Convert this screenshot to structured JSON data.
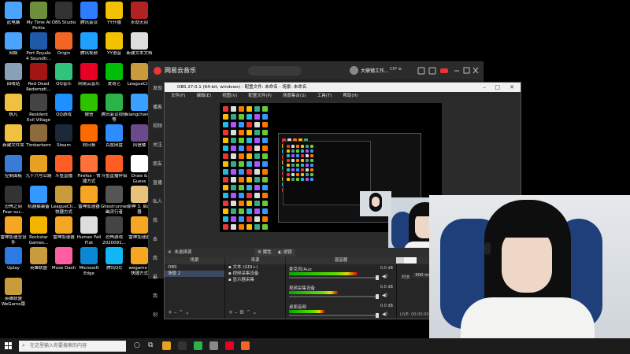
{
  "desktop_icons": [
    {
      "label": "此电脑",
      "color": "#4aa3ff"
    },
    {
      "label": "My Time At Portia",
      "color": "#6b8f3a"
    },
    {
      "label": "OBS Studio",
      "color": "#333333"
    },
    {
      "label": "腾讯会议",
      "color": "#2d7cff"
    },
    {
      "label": "YY开播",
      "color": "#f2c200"
    },
    {
      "label": "永劫无间",
      "color": "#b22222"
    },
    {
      "label": "网络",
      "color": "#4aa3ff"
    },
    {
      "label": "Port Royale 4 Soundtr...",
      "color": "#1e5aa8"
    },
    {
      "label": "Origin",
      "color": "#f26522"
    },
    {
      "label": "腾讯视频",
      "color": "#1fa0ff"
    },
    {
      "label": "YY语音",
      "color": "#f2c200"
    },
    {
      "label": "新建文本文档",
      "color": "#dddddd"
    },
    {
      "label": "回收站",
      "color": "#8aa0b8"
    },
    {
      "label": "Red Dead Redempti...",
      "color": "#a31515"
    },
    {
      "label": "QQ音乐",
      "color": "#31c27c"
    },
    {
      "label": "网易云音乐",
      "color": "#e60026"
    },
    {
      "label": "爱奇艺",
      "color": "#00be06"
    },
    {
      "label": "LeagueCl...",
      "color": "#c89b3c"
    },
    {
      "label": "帆凡",
      "color": "#f0c040"
    },
    {
      "label": "Resident Evil Village",
      "color": "#444444"
    },
    {
      "label": "QQ游戏",
      "color": "#1e90ff"
    },
    {
      "label": "微信",
      "color": "#2dc100"
    },
    {
      "label": "腾讯会议视频等",
      "color": "#2bb34a"
    },
    {
      "label": "xiangchan...",
      "color": "#3aa0ff"
    },
    {
      "label": "新建文件夹",
      "color": "#f0c040"
    },
    {
      "label": "Timberborn",
      "color": "#8b6b3a"
    },
    {
      "label": "Steam",
      "color": "#1b2838"
    },
    {
      "label": "向日葵",
      "color": "#ff6a00"
    },
    {
      "label": "百度网盘",
      "color": "#2f8cff"
    },
    {
      "label": "风信楼",
      "color": "#6a4a8a"
    },
    {
      "label": "控制面板",
      "color": "#3a7bd5"
    },
    {
      "label": "九十六号公路",
      "color": "#e8a020"
    },
    {
      "label": "斗鱼直播",
      "color": "#ff5d23"
    },
    {
      "label": "Firefox - 快捷方式",
      "color": "#ff7139"
    },
    {
      "label": "斗鱼直播伴侣",
      "color": "#ff5d23"
    },
    {
      "label": "Draw & Guess",
      "color": "#ffffff"
    },
    {
      "label": "恐怖之间 Fear sur...",
      "color": "#333333"
    },
    {
      "label": "机器猫装备",
      "color": "#3399ff"
    },
    {
      "label": "LeagueCli... 快捷方式",
      "color": "#c89b3c"
    },
    {
      "label": "雷神加速器",
      "color": "#f5a623"
    },
    {
      "label": "Ghostrunner 幽灵行者",
      "color": "#555555"
    },
    {
      "label": "原神 3. 启动器",
      "color": "#e6c27a"
    },
    {
      "label": "雷神加速全设件",
      "color": "#f5a623"
    },
    {
      "label": "Rockstar Games...",
      "color": "#f4b400"
    },
    {
      "label": "雷神加速器",
      "color": "#f5a623"
    },
    {
      "label": "Human Fall Flat",
      "color": "#dddddd"
    },
    {
      "label": "恐怖游戏 2020091...",
      "color": "#444444"
    },
    {
      "label": "雷神加速器",
      "color": "#f5a623"
    },
    {
      "label": "Uplay",
      "color": "#2c7be5"
    },
    {
      "label": "英雄联盟",
      "color": "#c89b3c"
    },
    {
      "label": "Muse Dash",
      "color": "#ff5fa2"
    },
    {
      "label": "Microsoft Edge",
      "color": "#0c87d6"
    },
    {
      "label": "腾讯QQ",
      "color": "#12b7f5"
    },
    {
      "label": "wegame - 快捷方式",
      "color": "#f5a623"
    },
    {
      "label": "英雄联盟 WeGame版",
      "color": "#c89b3c"
    }
  ],
  "netease": {
    "title": "网易云音乐",
    "search_placeholder": "",
    "username": "大鼎镇工作...",
    "vip": "CIP ≡",
    "side_items": [
      "发现",
      "播客",
      "视频",
      "关注",
      "朋友",
      "直播",
      "私人",
      "我",
      "本",
      "我",
      "最",
      "我",
      "创"
    ]
  },
  "obs": {
    "title": "OBS 27.0.1 (64-bit, windows) - 配置文件: 未命名 - 场景: 未命名",
    "menu": [
      "文件(F)",
      "编辑(E)",
      "视图(V)",
      "配置文件(P)",
      "场景集合(S)",
      "工具(T)",
      "帮助(H)"
    ],
    "no_source": "未选择源",
    "properties_label": "属性",
    "filters_label": "滤镜",
    "docks": {
      "scenes": "场景",
      "sources": "来源",
      "mixer": "混音器",
      "transitions": "转场"
    },
    "scenes": [
      "OBS",
      "场景 2"
    ],
    "sources": [
      "文本 (GDI+)",
      "视频采集设备",
      "显示器采集"
    ],
    "mixer": [
      {
        "name": "麦克风/Aux",
        "db": "0.0 dB",
        "level": 0.78
      },
      {
        "name": "视频采集设备",
        "db": "0.0 dB",
        "level": 0.55
      },
      {
        "name": "桌面音频",
        "db": "0.0 dB",
        "level": 0.4
      }
    ],
    "status": "LIVE: 00:00:00   REC: 00:00:00   CPU",
    "transition_duration_label": "时长",
    "transition_duration": "300 ms"
  },
  "taskbar": {
    "search_placeholder": "在这里输入你要搜索的内容",
    "icon_colors": [
      "#e8a020",
      "#333333",
      "#2bb34a",
      "#888888",
      "#e60026",
      "#f26522"
    ]
  },
  "colors": {
    "accent": "#3b4a61",
    "netease_red": "#e60026"
  }
}
